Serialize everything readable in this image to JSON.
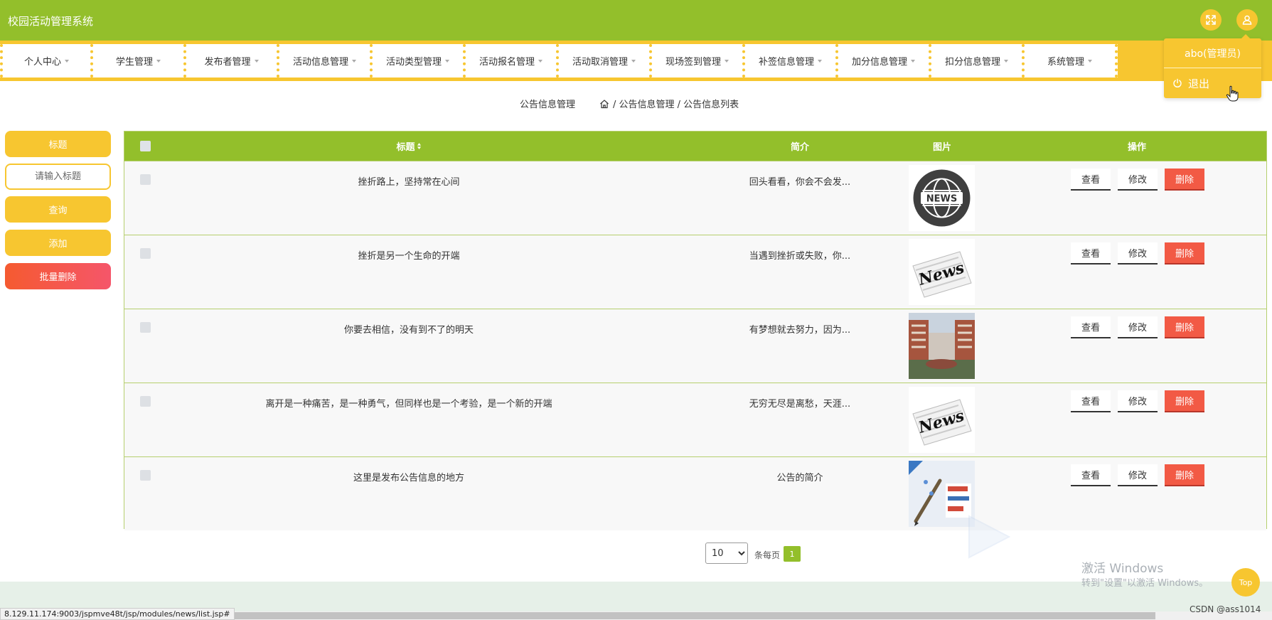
{
  "app": {
    "title": "校园活动管理系统"
  },
  "header": {
    "fullscreen_icon": "expand-icon",
    "user_icon": "user-icon"
  },
  "user_menu": {
    "username": "abo(管理员)",
    "logout_label": "退出"
  },
  "nav": {
    "items": [
      {
        "label": "个人中心"
      },
      {
        "label": "学生管理"
      },
      {
        "label": "发布者管理"
      },
      {
        "label": "活动信息管理"
      },
      {
        "label": "活动类型管理"
      },
      {
        "label": "活动报名管理"
      },
      {
        "label": "活动取消管理"
      },
      {
        "label": "现场签到管理"
      },
      {
        "label": "补签信息管理"
      },
      {
        "label": "加分信息管理"
      },
      {
        "label": "扣分信息管理"
      },
      {
        "label": "系统管理"
      }
    ]
  },
  "breadcrumb": {
    "page_title": "公告信息管理",
    "path": "/ 公告信息管理 / 公告信息列表"
  },
  "sidebar": {
    "field_label": "标题",
    "input_placeholder": "请输入标题",
    "query_label": "查询",
    "add_label": "添加",
    "batch_delete_label": "批量删除"
  },
  "table": {
    "headers": {
      "title": "标题",
      "intro": "简介",
      "image": "图片",
      "actions": "操作"
    },
    "rows": [
      {
        "title": "挫折路上，坚持常在心间",
        "intro": "回头看看，你会不会发...",
        "image": "news-globe-icon"
      },
      {
        "title": "挫折是另一个生命的开端",
        "intro": "当遇到挫折或失败，你...",
        "image": "newspaper-icon"
      },
      {
        "title": "你要去相信，没有到不了的明天",
        "intro": "有梦想就去努力，因为...",
        "image": "campus-photo"
      },
      {
        "title": "离开是一种痛苦，是一种勇气，但同样也是一个考验，是一个新的开端",
        "intro": "无穷无尽是离愁，天涯...",
        "image": "newspaper-icon"
      },
      {
        "title": "这里是发布公告信息的地方",
        "intro": "公告的简介",
        "image": "poster-image"
      }
    ],
    "action_labels": {
      "view": "查看",
      "edit": "修改",
      "delete": "删除"
    }
  },
  "pagination": {
    "page_size": "10",
    "page_size_options": [
      "10"
    ],
    "per_page_label": "条每页",
    "current_page": "1"
  },
  "overlay": {
    "windows_title": "激活 Windows",
    "windows_sub": "转到\"设置\"以激活 Windows。",
    "top_label": "Top",
    "status_url": "8.129.11.174:9003/jspmve48t/jsp/modules/news/list.jsp#",
    "csdn": "CSDN @ass1014"
  },
  "colors": {
    "primary_green": "#93bf2b",
    "accent_yellow": "#f7c630",
    "danger_red": "#f25a45"
  }
}
